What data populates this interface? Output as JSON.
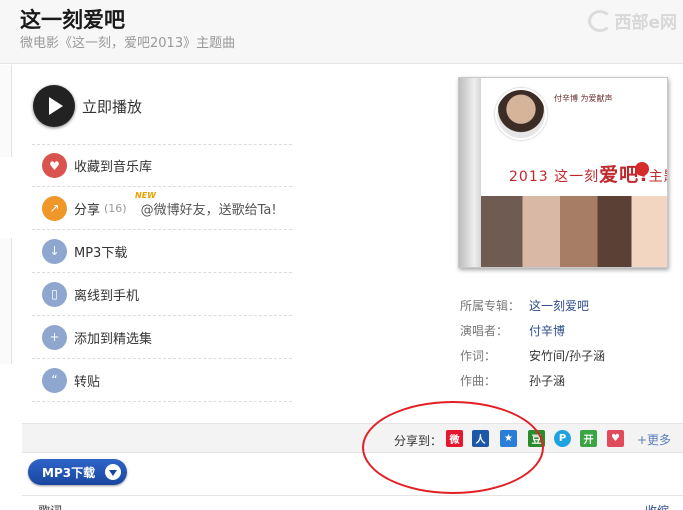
{
  "header": {
    "title": "这一刻爱吧",
    "subtitle": "微电影《这一刻，爱吧2013》主题曲",
    "watermark": "西部e网"
  },
  "play": {
    "label": "立即播放"
  },
  "actions": [
    {
      "id": "collect",
      "label": "收藏到音乐库",
      "icon": "heart-icon",
      "color": "#d9534f"
    },
    {
      "id": "share",
      "label": "分享",
      "count": "(16)",
      "badge": "NEW",
      "hint": "@微博好友，送歌给Ta!",
      "icon": "share-icon",
      "color": "#f0972a"
    },
    {
      "id": "mp3",
      "label": "MP3下载",
      "icon": "download-icon",
      "color": "#8fa7cf"
    },
    {
      "id": "offline",
      "label": "离线到手机",
      "icon": "phone-icon",
      "color": "#8fa7cf"
    },
    {
      "id": "add",
      "label": "添加到精选集",
      "icon": "plus-icon",
      "color": "#8fa7cf"
    },
    {
      "id": "repost",
      "label": "转贴",
      "icon": "quote-icon",
      "color": "#8fa7cf"
    }
  ],
  "cover": {
    "artist_note": "付辛博 为爱献声",
    "text_pre": "2013 这一刻",
    "text_big": "爱吧!",
    "text_post": "主题曲"
  },
  "meta": [
    {
      "key": "所属专辑：",
      "value": "这一刻爱吧",
      "link": true
    },
    {
      "key": "演唱者：",
      "value": "付辛博",
      "link": true
    },
    {
      "key": "作词：",
      "value": "安竹间/孙子涵",
      "link": false
    },
    {
      "key": "作曲：",
      "value": "孙子涵",
      "link": false
    }
  ],
  "share_bar": {
    "label": "分享到：",
    "more": "+更多",
    "icons": [
      {
        "name": "weibo-icon",
        "glyph": "微",
        "color": "#e6162d"
      },
      {
        "name": "renren-icon",
        "glyph": "人",
        "color": "#1d58a8"
      },
      {
        "name": "qzone-icon",
        "glyph": "★",
        "color": "#2b7ed8"
      },
      {
        "name": "douban-icon",
        "glyph": "豆",
        "color": "#2b8a2b"
      },
      {
        "name": "qq-weibo-icon",
        "glyph": "P",
        "color": "#1fa3e0"
      },
      {
        "name": "kaixin-icon",
        "glyph": "开",
        "color": "#3aa542"
      },
      {
        "name": "heart-share-icon",
        "glyph": "♥",
        "color": "#e04a5a"
      }
    ]
  },
  "download_button": {
    "label": "MP3下载"
  },
  "bottom": {
    "lyrics": "歌词",
    "collapse": "收缩"
  }
}
